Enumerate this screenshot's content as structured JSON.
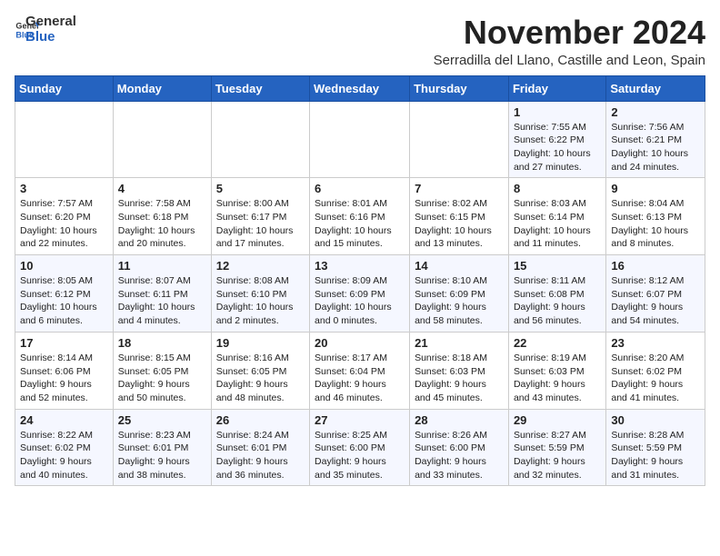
{
  "header": {
    "logo_general": "General",
    "logo_blue": "Blue",
    "month_title": "November 2024",
    "subtitle": "Serradilla del Llano, Castille and Leon, Spain"
  },
  "days_of_week": [
    "Sunday",
    "Monday",
    "Tuesday",
    "Wednesday",
    "Thursday",
    "Friday",
    "Saturday"
  ],
  "weeks": [
    [
      {
        "day": "",
        "info": ""
      },
      {
        "day": "",
        "info": ""
      },
      {
        "day": "",
        "info": ""
      },
      {
        "day": "",
        "info": ""
      },
      {
        "day": "",
        "info": ""
      },
      {
        "day": "1",
        "info": "Sunrise: 7:55 AM\nSunset: 6:22 PM\nDaylight: 10 hours and 27 minutes."
      },
      {
        "day": "2",
        "info": "Sunrise: 7:56 AM\nSunset: 6:21 PM\nDaylight: 10 hours and 24 minutes."
      }
    ],
    [
      {
        "day": "3",
        "info": "Sunrise: 7:57 AM\nSunset: 6:20 PM\nDaylight: 10 hours and 22 minutes."
      },
      {
        "day": "4",
        "info": "Sunrise: 7:58 AM\nSunset: 6:18 PM\nDaylight: 10 hours and 20 minutes."
      },
      {
        "day": "5",
        "info": "Sunrise: 8:00 AM\nSunset: 6:17 PM\nDaylight: 10 hours and 17 minutes."
      },
      {
        "day": "6",
        "info": "Sunrise: 8:01 AM\nSunset: 6:16 PM\nDaylight: 10 hours and 15 minutes."
      },
      {
        "day": "7",
        "info": "Sunrise: 8:02 AM\nSunset: 6:15 PM\nDaylight: 10 hours and 13 minutes."
      },
      {
        "day": "8",
        "info": "Sunrise: 8:03 AM\nSunset: 6:14 PM\nDaylight: 10 hours and 11 minutes."
      },
      {
        "day": "9",
        "info": "Sunrise: 8:04 AM\nSunset: 6:13 PM\nDaylight: 10 hours and 8 minutes."
      }
    ],
    [
      {
        "day": "10",
        "info": "Sunrise: 8:05 AM\nSunset: 6:12 PM\nDaylight: 10 hours and 6 minutes."
      },
      {
        "day": "11",
        "info": "Sunrise: 8:07 AM\nSunset: 6:11 PM\nDaylight: 10 hours and 4 minutes."
      },
      {
        "day": "12",
        "info": "Sunrise: 8:08 AM\nSunset: 6:10 PM\nDaylight: 10 hours and 2 minutes."
      },
      {
        "day": "13",
        "info": "Sunrise: 8:09 AM\nSunset: 6:09 PM\nDaylight: 10 hours and 0 minutes."
      },
      {
        "day": "14",
        "info": "Sunrise: 8:10 AM\nSunset: 6:09 PM\nDaylight: 9 hours and 58 minutes."
      },
      {
        "day": "15",
        "info": "Sunrise: 8:11 AM\nSunset: 6:08 PM\nDaylight: 9 hours and 56 minutes."
      },
      {
        "day": "16",
        "info": "Sunrise: 8:12 AM\nSunset: 6:07 PM\nDaylight: 9 hours and 54 minutes."
      }
    ],
    [
      {
        "day": "17",
        "info": "Sunrise: 8:14 AM\nSunset: 6:06 PM\nDaylight: 9 hours and 52 minutes."
      },
      {
        "day": "18",
        "info": "Sunrise: 8:15 AM\nSunset: 6:05 PM\nDaylight: 9 hours and 50 minutes."
      },
      {
        "day": "19",
        "info": "Sunrise: 8:16 AM\nSunset: 6:05 PM\nDaylight: 9 hours and 48 minutes."
      },
      {
        "day": "20",
        "info": "Sunrise: 8:17 AM\nSunset: 6:04 PM\nDaylight: 9 hours and 46 minutes."
      },
      {
        "day": "21",
        "info": "Sunrise: 8:18 AM\nSunset: 6:03 PM\nDaylight: 9 hours and 45 minutes."
      },
      {
        "day": "22",
        "info": "Sunrise: 8:19 AM\nSunset: 6:03 PM\nDaylight: 9 hours and 43 minutes."
      },
      {
        "day": "23",
        "info": "Sunrise: 8:20 AM\nSunset: 6:02 PM\nDaylight: 9 hours and 41 minutes."
      }
    ],
    [
      {
        "day": "24",
        "info": "Sunrise: 8:22 AM\nSunset: 6:02 PM\nDaylight: 9 hours and 40 minutes."
      },
      {
        "day": "25",
        "info": "Sunrise: 8:23 AM\nSunset: 6:01 PM\nDaylight: 9 hours and 38 minutes."
      },
      {
        "day": "26",
        "info": "Sunrise: 8:24 AM\nSunset: 6:01 PM\nDaylight: 9 hours and 36 minutes."
      },
      {
        "day": "27",
        "info": "Sunrise: 8:25 AM\nSunset: 6:00 PM\nDaylight: 9 hours and 35 minutes."
      },
      {
        "day": "28",
        "info": "Sunrise: 8:26 AM\nSunset: 6:00 PM\nDaylight: 9 hours and 33 minutes."
      },
      {
        "day": "29",
        "info": "Sunrise: 8:27 AM\nSunset: 5:59 PM\nDaylight: 9 hours and 32 minutes."
      },
      {
        "day": "30",
        "info": "Sunrise: 8:28 AM\nSunset: 5:59 PM\nDaylight: 9 hours and 31 minutes."
      }
    ]
  ]
}
